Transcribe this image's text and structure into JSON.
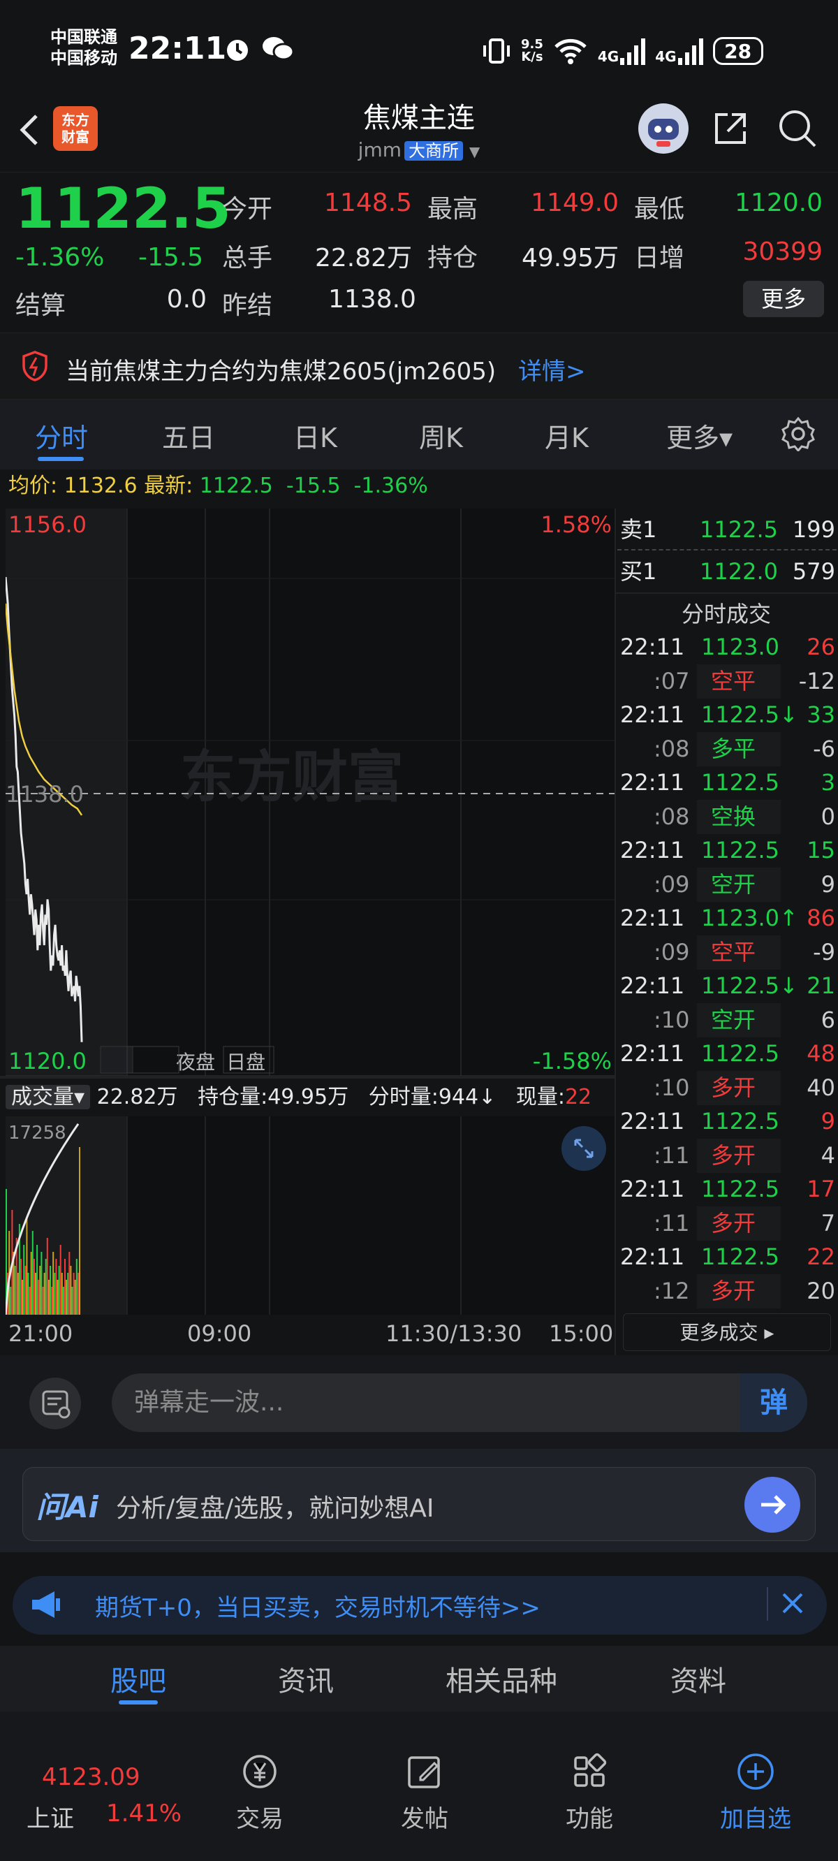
{
  "status_bar": {
    "carrier1": "中国联通",
    "carrier2": "中国移动",
    "time": "22:11",
    "net_speed_value": "9.5",
    "net_speed_unit": "K/s",
    "signal1": "4G",
    "signal2": "4G",
    "battery": "28"
  },
  "header": {
    "app_logo_line1": "东方",
    "app_logo_line2": "财富",
    "title": "焦煤主连",
    "code": "jmm",
    "exchange": "大商所"
  },
  "quote": {
    "last_price": "1122.5",
    "change_pct": "-1.36%",
    "change_val": "-15.5",
    "labels": {
      "open": "今开",
      "high": "最高",
      "low": "最低",
      "volume": "总手",
      "oi": "持仓",
      "oi_chg": "日增",
      "settle": "结算",
      "pre_settle": "昨结"
    },
    "open": "1148.5",
    "high": "1149.0",
    "low": "1120.0",
    "volume": "22.82万",
    "oi": "49.95万",
    "oi_chg": "30399",
    "settle": "0.0",
    "pre_settle": "1138.0",
    "more": "更多"
  },
  "notice": {
    "text": "当前焦煤主力合约为焦煤2605(jm2605)",
    "link": "详情>"
  },
  "chart_tabs": [
    "分时",
    "五日",
    "日K",
    "周K",
    "月K",
    "更多▾"
  ],
  "avg_row": {
    "avg_label": "均价:",
    "avg_value": "1132.6",
    "last_label": "最新:",
    "last_value": "1122.5",
    "chg": "-15.5",
    "pct": "-1.36%"
  },
  "chart_labels": {
    "top_price": "1156.0",
    "top_pct": "1.58%",
    "mid_price": "1138.0",
    "bottom_price": "1120.0",
    "bottom_pct": "-1.58%",
    "night": "夜盘",
    "day": "日盘",
    "watermark": "东方财富",
    "vol_max": "17258",
    "times": [
      "21:00",
      "09:00",
      "11:30/13:30",
      "15:00"
    ]
  },
  "volume_row": {
    "tag": "成交量▾",
    "total": "22.82万",
    "oi_label": "持仓量:",
    "oi": "49.95万",
    "tick_label": "分时量:",
    "tick": "944↓",
    "cur_label": "现量:",
    "cur": "22"
  },
  "orderbook": {
    "title": "分时成交",
    "ask_label": "卖1",
    "ask_price": "1122.5",
    "ask_vol": "199",
    "bid_label": "买1",
    "bid_price": "1122.0",
    "bid_vol": "579",
    "trades": [
      {
        "t": "22:11",
        "p": "1123.0",
        "pc": "green",
        "v": "26",
        "vc": "red",
        "s": ":07",
        "k": "空平",
        "kc": "red",
        "o": "-12"
      },
      {
        "t": "22:11",
        "p": "1122.5↓",
        "pc": "green",
        "v": "33",
        "vc": "green",
        "s": ":08",
        "k": "多平",
        "kc": "green",
        "o": "-6"
      },
      {
        "t": "22:11",
        "p": "1122.5",
        "pc": "green",
        "v": "3",
        "vc": "green",
        "s": ":08",
        "k": "空换",
        "kc": "green",
        "o": "0"
      },
      {
        "t": "22:11",
        "p": "1122.5",
        "pc": "green",
        "v": "15",
        "vc": "green",
        "s": ":09",
        "k": "空开",
        "kc": "green",
        "o": "9"
      },
      {
        "t": "22:11",
        "p": "1123.0↑",
        "pc": "green",
        "v": "86",
        "vc": "red",
        "s": ":09",
        "k": "空平",
        "kc": "red",
        "o": "-9"
      },
      {
        "t": "22:11",
        "p": "1122.5↓",
        "pc": "green",
        "v": "21",
        "vc": "green",
        "s": ":10",
        "k": "空开",
        "kc": "green",
        "o": "6"
      },
      {
        "t": "22:11",
        "p": "1122.5",
        "pc": "green",
        "v": "48",
        "vc": "red",
        "s": ":10",
        "k": "多开",
        "kc": "red",
        "o": "40"
      },
      {
        "t": "22:11",
        "p": "1122.5",
        "pc": "green",
        "v": "9",
        "vc": "red",
        "s": ":11",
        "k": "多开",
        "kc": "red",
        "o": "4"
      },
      {
        "t": "22:11",
        "p": "1122.5",
        "pc": "green",
        "v": "17",
        "vc": "red",
        "s": ":11",
        "k": "多开",
        "kc": "red",
        "o": "7"
      },
      {
        "t": "22:11",
        "p": "1122.5",
        "pc": "green",
        "v": "22",
        "vc": "red",
        "s": ":12",
        "k": "多开",
        "kc": "red",
        "o": "20"
      }
    ],
    "more": "更多成交 ▸"
  },
  "comment": {
    "placeholder": "弹幕走一波...",
    "btn": "弹"
  },
  "ai": {
    "logo": "问Ai",
    "text": "分析/复盘/选股，就问妙想AI"
  },
  "promo": {
    "text": "期货T+0，当日买卖，交易时机不等待>>"
  },
  "bottom_tabs": [
    "股吧",
    "资讯",
    "相关品种",
    "资料"
  ],
  "bottom_nav": {
    "index_value": "4123.09",
    "index_name": "上证",
    "index_pct": "1.41%",
    "items": [
      "交易",
      "发帖",
      "功能",
      "加自选"
    ]
  },
  "colors": {
    "up": "#f23b3b",
    "down": "#1fd14a",
    "accent": "#3f8ef5",
    "avg_line": "#f0d040"
  },
  "icons": [
    "back-icon",
    "search-icon",
    "share-icon",
    "gear-icon",
    "warning-icon",
    "megaphone-icon",
    "close-icon",
    "arrow-right-icon",
    "expand-icon"
  ]
}
